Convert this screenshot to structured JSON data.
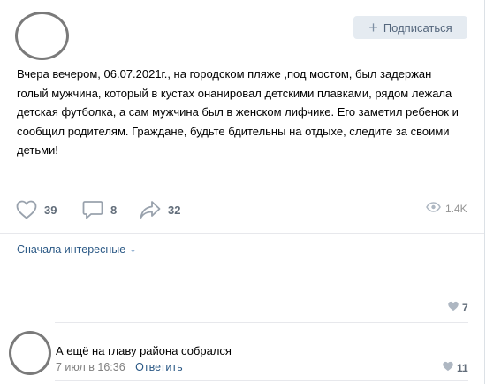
{
  "post": {
    "subscribe_label": "Подписаться",
    "text": "Вчера вечером, 06.07.2021г., на городском пляже ,под мостом, был задержан\nголый мужчина, который в кустах онанировал детскими плавками, рядом лежала\nдетская футболка, а сам мужчина был в женском лифчике. Его заметил ребенок и\nсообщил родителям. Граждане, будьте бдительны на отдыхе, следите за своими\nдетьми!",
    "likes": "39",
    "comments": "8",
    "shares": "32",
    "views": "1.4K"
  },
  "comments_section": {
    "sort_label": "Сначала интересные",
    "previous_comment_likes": "7",
    "comment": {
      "text": "А ещё на главу района собрался",
      "date": "7 июл в 16:36",
      "reply_label": "Ответить",
      "likes": "11"
    }
  },
  "colors": {
    "accent": "#2a5885",
    "button_bg": "#e5ebf1",
    "icon": "#99a2ad"
  }
}
